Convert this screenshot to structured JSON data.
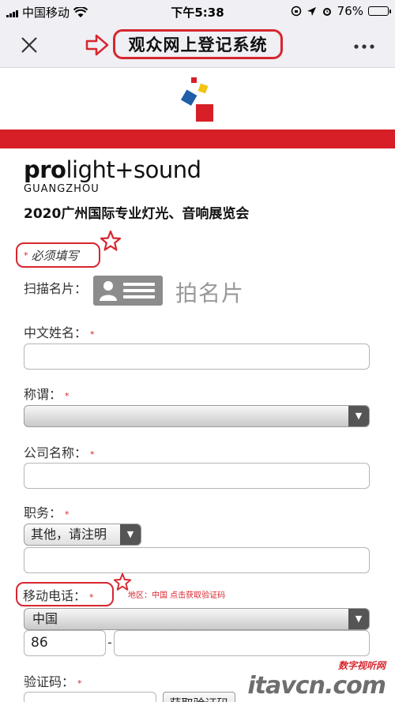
{
  "status_bar": {
    "carrier": "中国移动",
    "time": "下午5:38",
    "battery": "76%",
    "battery_level": 0.76
  },
  "nav": {
    "title": "观众网上登记系统",
    "close_icon": "close-icon",
    "more_icon": "more-icon"
  },
  "brand": {
    "name_bold": "pro",
    "name_rest": "light+sound",
    "city": "GUANGZHOU",
    "expo_title": "2020广州国际专业灯光、音响展览会"
  },
  "form": {
    "required_note": "必须填写",
    "asterisk": "*",
    "scan_card_label": "扫描名片：",
    "scan_card_text": "拍名片",
    "chinese_name_label": "中文姓名：",
    "title_label": "称谓：",
    "title_value": "",
    "company_label": "公司名称：",
    "position_label": "职务：",
    "position_value": "其他，请注明",
    "mobile_label": "移动电话：",
    "mobile_hint": "地区：中国  点击获取验证码",
    "region_value": "中国",
    "country_code": "86",
    "dash": "-",
    "verify_label": "验证码：",
    "verify_button": "获取验证码"
  },
  "watermark": {
    "top": "数字视听网",
    "main": "itavcn.com"
  },
  "colors": {
    "accent_red": "#d7262e",
    "band_red": "#d61f26",
    "nav_bg": "#efeff4"
  }
}
